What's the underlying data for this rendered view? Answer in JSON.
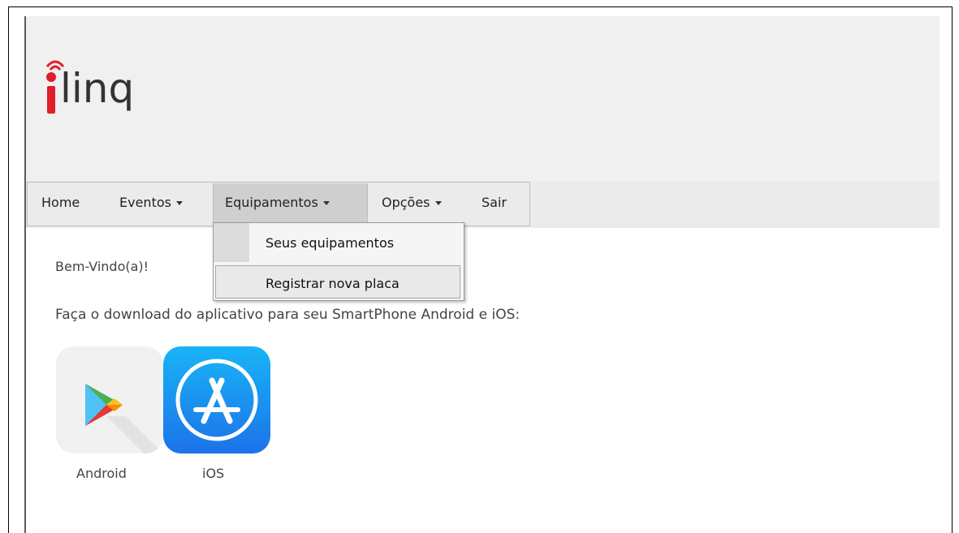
{
  "brand": {
    "logo_text": "linq",
    "logo_letter": "i",
    "accent": "#e01e2a"
  },
  "nav": {
    "items": [
      {
        "label": "Home",
        "has_caret": false
      },
      {
        "label": "Eventos",
        "has_caret": true
      },
      {
        "label": "Equipamentos",
        "has_caret": true,
        "active": true
      },
      {
        "label": "Opções",
        "has_caret": true
      },
      {
        "label": "Sair",
        "has_caret": false
      }
    ]
  },
  "dropdown": {
    "items": [
      {
        "label": "Seus equipamentos"
      },
      {
        "label": "Registrar nova placa",
        "hovered": true
      }
    ]
  },
  "main": {
    "welcome": "Bem-Vindo(a)!",
    "download_text": "Faça o download do aplicativo para seu SmartPhone Android e iOS:",
    "apps": [
      {
        "label": "Android",
        "icon": "google-play-icon"
      },
      {
        "label": "iOS",
        "icon": "app-store-icon"
      }
    ]
  }
}
